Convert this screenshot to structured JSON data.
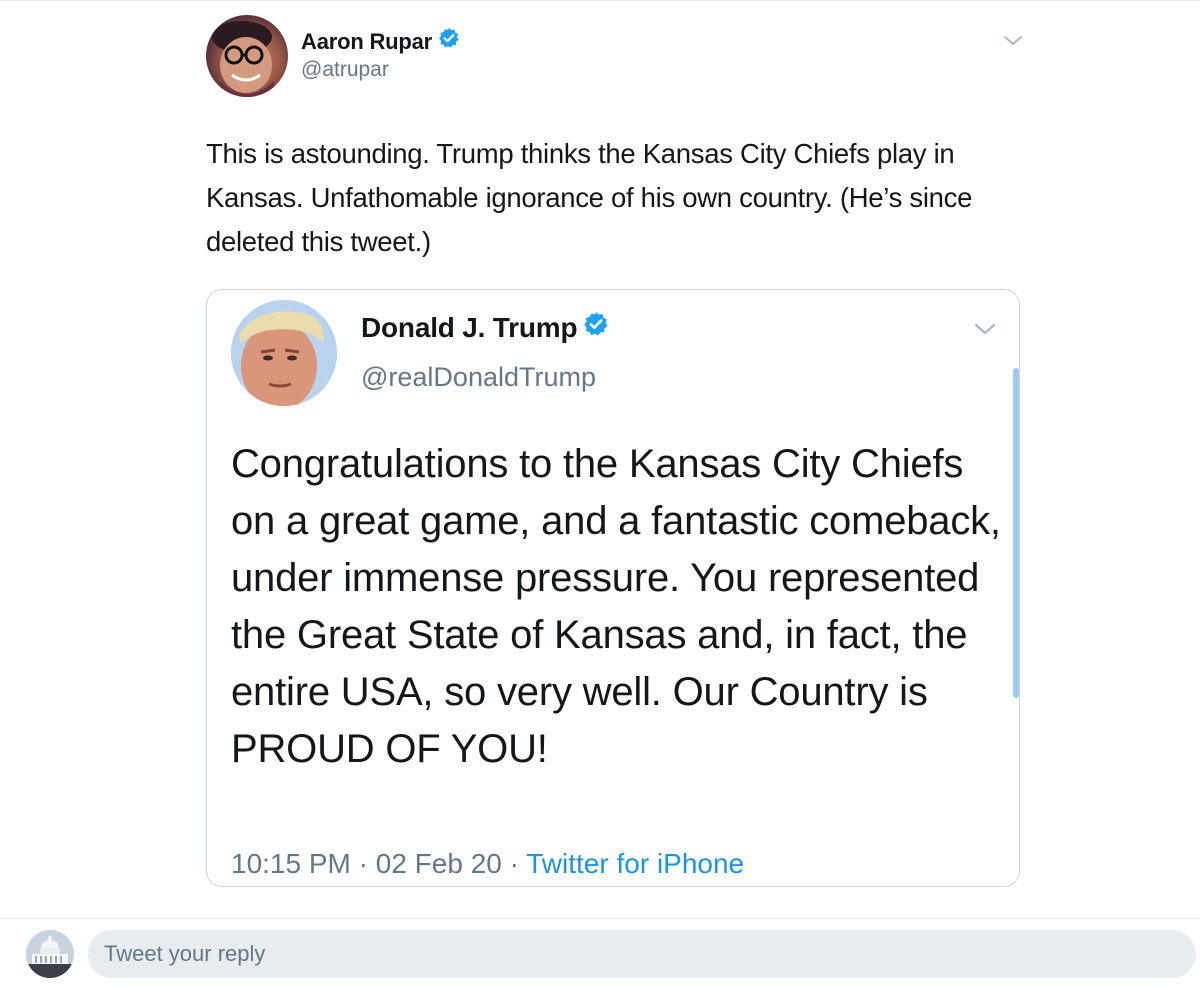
{
  "tweet": {
    "author_name": "Aaron Rupar",
    "author_handle": "@atrupar",
    "avatar_icon": "user-avatar-icon",
    "verified_icon": "verified-badge-icon",
    "menu_icon": "chevron-down-icon",
    "text": "This is astounding. Trump thinks the Kansas City Chiefs play in Kansas. Unfathomable ignorance of his own country. (He’s since deleted this tweet.)"
  },
  "quoted_tweet": {
    "author_name": "Donald J. Trump",
    "author_handle": "@realDonaldTrump",
    "avatar_icon": "user-avatar-icon",
    "verified_icon": "verified-badge-icon",
    "menu_icon": "chevron-down-icon",
    "text": "Congratulations to the Kansas City Chiefs on a great game, and a fantastic comeback, under immense pressure. You represented the Great State of Kansas and, in fact, the entire USA, so very well. Our Country is PROUD OF YOU!",
    "time": "10:15 PM",
    "separator": "·",
    "date": "02 Feb 20",
    "source": "Twitter for iPhone"
  },
  "reply": {
    "avatar_icon": "capitol-avatar-icon",
    "placeholder": "Tweet your reply"
  },
  "colors": {
    "text_primary": "#14171a",
    "text_secondary": "#657786",
    "link": "#1b95e0",
    "verified": "#1da1f2",
    "border": "#ccd6dd",
    "input_background": "#e6ecf0"
  }
}
